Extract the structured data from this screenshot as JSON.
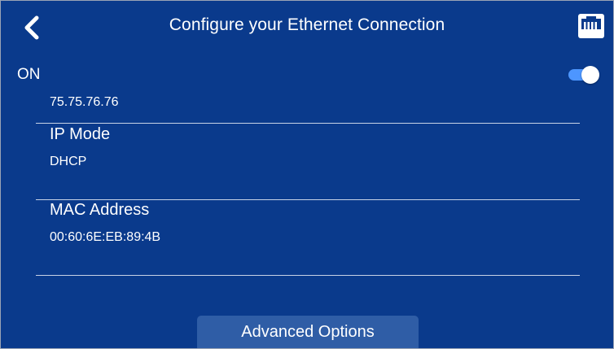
{
  "header": {
    "title": "Configure your Ethernet Connection",
    "back_icon": "chevron-left-icon",
    "status_icon": "ethernet-port-icon"
  },
  "toggle": {
    "label": "ON",
    "state": "on",
    "accent_color": "#4d96ff"
  },
  "list": {
    "partial_value": "75.75.76.76",
    "items": [
      {
        "label": "IP Mode",
        "value": "DHCP"
      },
      {
        "label": "MAC Address",
        "value": "00:60:6E:EB:89:4B"
      }
    ]
  },
  "footer": {
    "advanced_label": "Advanced Options"
  },
  "colors": {
    "background": "#0a3a8c",
    "button": "#2f5da6",
    "divider": "#c8d2e6",
    "text": "#ffffff"
  }
}
